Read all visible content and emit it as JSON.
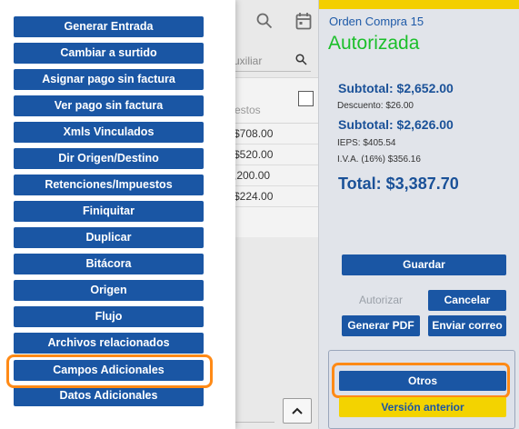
{
  "background": {
    "auxiliar_text": "uxiliar",
    "table_header": "estos",
    "rows": [
      "$708.00",
      "$520.00",
      ",200.00",
      "$224.00"
    ]
  },
  "order": {
    "title": "Orden Compra 15",
    "status": "Autorizada",
    "subtotal1": "Subtotal: $2,652.00",
    "descuento": "Descuento: $26.00",
    "subtotal2": "Subtotal: $2,626.00",
    "ieps": "IEPS: $405.54",
    "iva": "I.V.A. (16%) $356.16",
    "total": "Total: $3,387.70",
    "accent_color": "#1a56a4",
    "status_color": "#1bbf2a"
  },
  "actions": {
    "guardar": "Guardar",
    "autorizar": "Autorizar",
    "cancelar": "Cancelar",
    "generar_pdf": "Generar PDF",
    "enviar_correo": "Enviar correo",
    "otros": "Otros",
    "version_anterior": "Versión anterior"
  },
  "menu": {
    "items": [
      "Generar Entrada",
      "Cambiar a surtido",
      "Asignar pago sin factura",
      "Ver pago sin factura",
      "Xmls Vinculados",
      "Dir Origen/Destino",
      "Retenciones/Impuestos",
      "Finiquitar",
      "Duplicar",
      "Bitácora",
      "Origen",
      "Flujo",
      "Archivos relacionados",
      "Campos Adicionales",
      "Datos Adicionales"
    ],
    "highlighted_item": "Campos Adicionales",
    "highlight_color": "#ff8a16"
  }
}
